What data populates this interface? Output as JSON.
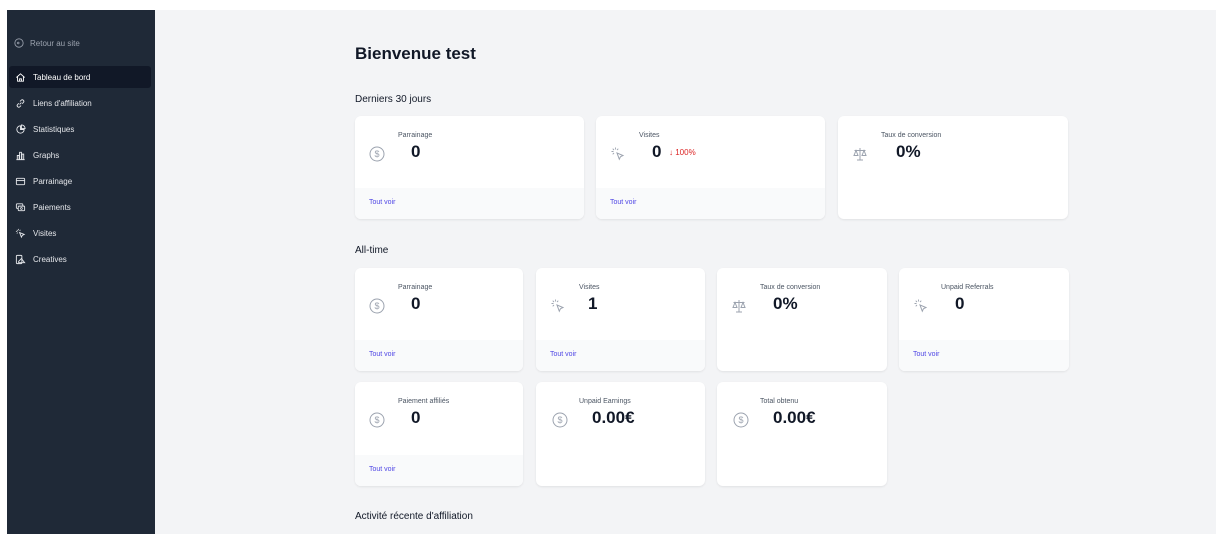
{
  "sidebar": {
    "back_label": "Retour au site",
    "items": [
      {
        "label": "Tableau de bord",
        "icon": "home-icon",
        "active": true
      },
      {
        "label": "Liens d'affiliation",
        "icon": "link-icon"
      },
      {
        "label": "Statistiques",
        "icon": "pie-chart-icon"
      },
      {
        "label": "Graphs",
        "icon": "bar-chart-icon"
      },
      {
        "label": "Parrainage",
        "icon": "credit-card-icon"
      },
      {
        "label": "Paiements",
        "icon": "payments-icon"
      },
      {
        "label": "Visites",
        "icon": "cursor-click-icon"
      },
      {
        "label": "Creatives",
        "icon": "creatives-icon"
      }
    ]
  },
  "page": {
    "title": "Bienvenue test",
    "recent_section": "Derniers 30 jours",
    "alltime_section": "All-time",
    "activity_section": "Activité récente d'affiliation"
  },
  "recent_cards": [
    {
      "label": "Parrainage",
      "value": "0",
      "icon": "dollar-icon",
      "link": "Tout voir"
    },
    {
      "label": "Visites",
      "value": "0",
      "change": "↓ 100%",
      "icon": "cursor-click-icon",
      "link": "Tout voir"
    },
    {
      "label": "Taux de conversion",
      "value": "0%",
      "icon": "scale-icon"
    }
  ],
  "alltime_cards": [
    {
      "label": "Parrainage",
      "value": "0",
      "icon": "dollar-icon",
      "link": "Tout voir"
    },
    {
      "label": "Visites",
      "value": "1",
      "icon": "cursor-click-icon",
      "link": "Tout voir"
    },
    {
      "label": "Taux de conversion",
      "value": "0%",
      "icon": "scale-icon"
    },
    {
      "label": "Unpaid Referrals",
      "value": "0",
      "icon": "cursor-click-icon",
      "link": "Tout voir"
    },
    {
      "label": "Paiement affiliés",
      "value": "0",
      "icon": "dollar-icon",
      "link": "Tout voir"
    },
    {
      "label": "Unpaid Earnings",
      "value": "0.00€",
      "icon": "dollar-icon"
    },
    {
      "label": "Total obtenu",
      "value": "0.00€",
      "icon": "dollar-icon"
    }
  ],
  "colors": {
    "sidebar_bg": "#1f2937",
    "active_item_bg": "#111827",
    "link": "#4f46e5",
    "negative_change": "#dc2626",
    "page_bg": "#f3f4f6"
  }
}
